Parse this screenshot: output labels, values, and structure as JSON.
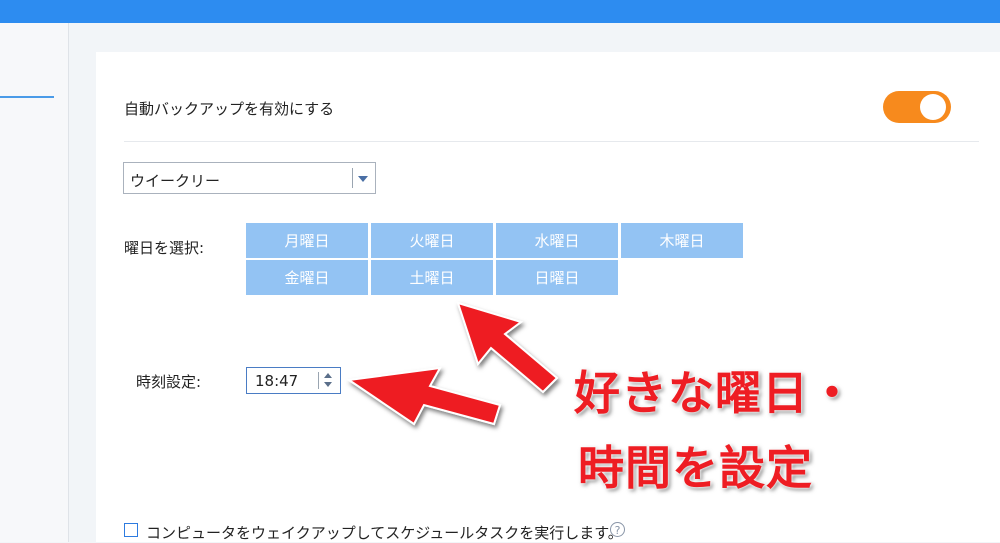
{
  "backup": {
    "auto_label": "自動バックアップを有効にする",
    "toggle_on": true
  },
  "frequency": {
    "selected": "ウイークリー"
  },
  "days": {
    "label": "曜日を選択:",
    "items": [
      "月曜日",
      "火曜日",
      "水曜日",
      "木曜日",
      "金曜日",
      "土曜日",
      "日曜日"
    ]
  },
  "time": {
    "label": "時刻設定:",
    "value": "18:47"
  },
  "wake": {
    "label": "コンピュータをウェイクアップしてスケジュールタスクを実行します。",
    "checked": false,
    "help": "?"
  },
  "annotation": {
    "line1": "好きな曜日・",
    "line2": "時間を設定"
  },
  "colors": {
    "topbar": "#2d8cf0",
    "toggle": "#f78a1d",
    "day_button": "#93c3f3",
    "annotation": "#ee1d23"
  }
}
